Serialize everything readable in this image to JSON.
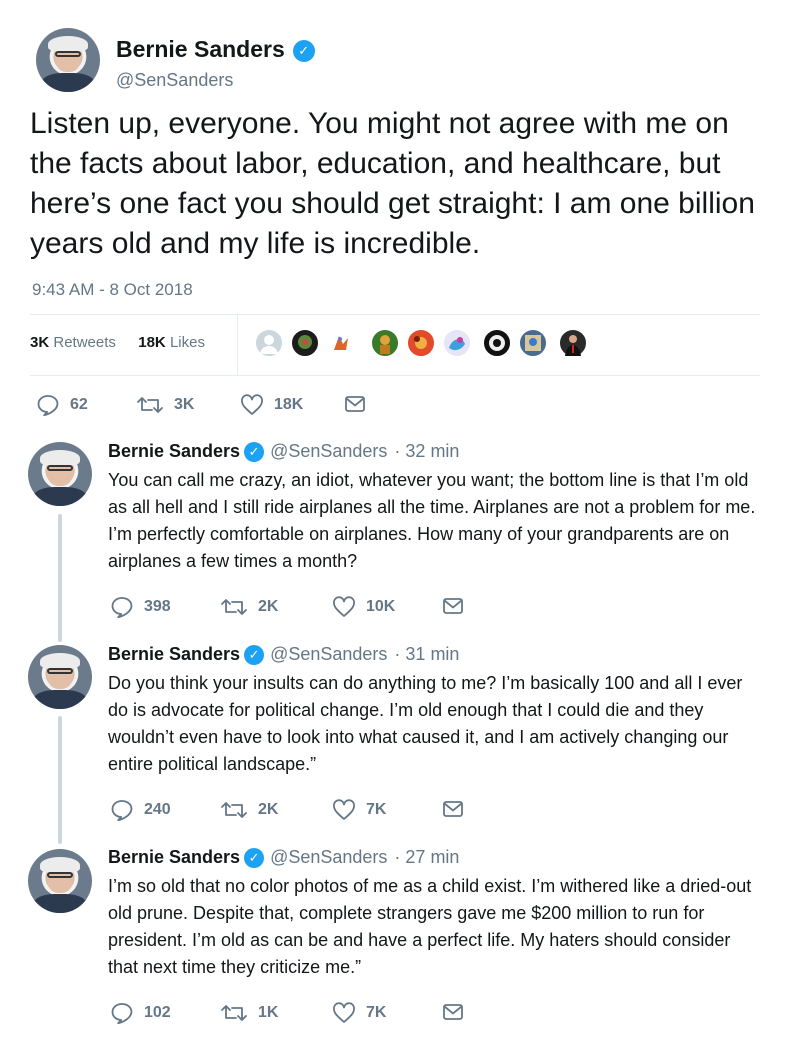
{
  "main_tweet": {
    "name": "Bernie Sanders",
    "handle": "@SenSanders",
    "text": "Listen up, everyone. You might not agree with me on the facts about labor, education, and healthcare, but here’s one fact you should get straight: I am one billion years old and my life is incredible.",
    "timestamp": "9:43 AM - 8 Oct 2018",
    "retweets_count": "3K",
    "retweets_label": "Retweets",
    "likes_count": "18K",
    "likes_label": "Likes",
    "likers": [
      "default-avatar",
      "avatar-2",
      "avatar-3",
      "avatar-4",
      "avatar-5",
      "avatar-6",
      "avatar-7",
      "avatar-8",
      "avatar-9"
    ],
    "actions": {
      "replies": "62",
      "retweets": "3K",
      "likes": "18K"
    }
  },
  "replies": [
    {
      "name": "Bernie Sanders",
      "handle": "@SenSanders",
      "time": "· 32 min",
      "text": "You can call me crazy, an idiot, whatever you want; the bottom line is that I’m old as all hell and I still ride airplanes all the time. Airplanes are not a problem for me. I’m perfectly comfortable on airplanes. How many of your grandparents are on airplanes a few times a month?",
      "actions": {
        "replies": "398",
        "retweets": "2K",
        "likes": "10K"
      }
    },
    {
      "name": "Bernie Sanders",
      "handle": "@SenSanders",
      "time": "· 31 min",
      "text": "Do you think your insults can do anything to me? I’m basically 100 and all I ever do is advocate for political change. I’m old enough that I could die and they wouldn’t even have to look into what caused it, and I am actively changing our entire political landscape.”",
      "actions": {
        "replies": "240",
        "retweets": "2K",
        "likes": "7K"
      }
    },
    {
      "name": "Bernie Sanders",
      "handle": "@SenSanders",
      "time": "· 27 min",
      "text": "I’m so old that no color photos of me as a child exist. I’m withered like a dried-out old prune. Despite that, complete strangers gave me $200 million to run for president. I’m old as can be and have a perfect life. My haters should consider that next time they criticize me.”",
      "actions": {
        "replies": "102",
        "retweets": "1K",
        "likes": "7K"
      }
    }
  ],
  "icons": {
    "verified": "verified-badge-icon",
    "reply": "reply-icon",
    "retweet": "retweet-icon",
    "like": "heart-icon",
    "dm": "envelope-icon"
  },
  "colors": {
    "verified": "#1da1f2",
    "secondary_text": "#657786",
    "thread_line": "#ccd6dd"
  }
}
